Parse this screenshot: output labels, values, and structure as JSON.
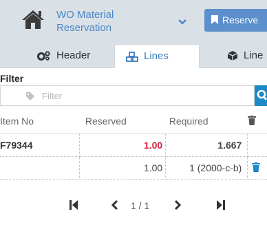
{
  "header": {
    "title": "WO Material Reservation",
    "reserve_label": "Reserve",
    "icons": {
      "home": "home-icon",
      "caret": "chevron-down-icon",
      "bookmark": "bookmark-icon"
    }
  },
  "tabs": [
    {
      "label": "Header",
      "icon": "gears-icon"
    },
    {
      "label": "Lines",
      "icon": "cubes-icon",
      "active": true
    },
    {
      "label": "Line",
      "icon": "cube-icon"
    }
  ],
  "filter": {
    "label": "Filter",
    "placeholder": "Filter",
    "value": ""
  },
  "table": {
    "columns": [
      "Item No",
      "Reserved",
      "Required"
    ],
    "rows": [
      {
        "item_no": "F79344",
        "reserved": "1.00",
        "required": "1.667"
      },
      {
        "item_no": "",
        "reserved": "1.00",
        "required": "1 (2000-c-b)"
      }
    ]
  },
  "pager": {
    "info": "1 / 1"
  },
  "colors": {
    "accent": "#5c8fcc",
    "link": "#3a7bbf",
    "search": "#1e88c9",
    "danger": "#d0203a",
    "bar": "#d9e0e6"
  }
}
